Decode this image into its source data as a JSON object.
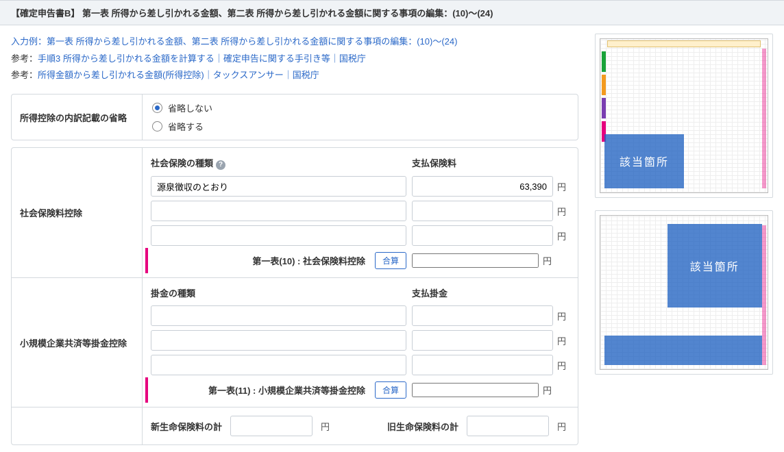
{
  "header": {
    "title": "【確定申告書B】 第一表 所得から差し引かれる金額、第二表 所得から差し引かれる金額に関する事項の編集：(10)〜(24)"
  },
  "links": {
    "example": "入力例：第一表 所得から差し引かれる金額、第二表 所得から差し引かれる金額に関する事項の編集：(10)〜(24)",
    "ref_prefix": "参考：",
    "ref1": "手順3 所得から差し引かれる金額を計算する｜確定申告に関する手引き等｜国税庁",
    "ref2": "所得金額から差し引かれる金額(所得控除)｜タックスアンサー｜国税庁"
  },
  "omit": {
    "label": "所得控除の内訳記載の省略",
    "opt_no": "省略しない",
    "opt_yes": "省略する",
    "selected": "no"
  },
  "yen": "円",
  "sum_btn": "合算",
  "social": {
    "section_label": "社会保険料控除",
    "type_head": "社会保険の種類",
    "amount_head": "支払保険料",
    "rows": [
      {
        "type": "源泉徴収のとおり",
        "amount": "63,390"
      },
      {
        "type": "",
        "amount": ""
      },
      {
        "type": "",
        "amount": ""
      }
    ],
    "total_label": "第一表(10) : 社会保険料控除",
    "total_value": ""
  },
  "sme": {
    "section_label": "小規模企業共済等掛金控除",
    "type_head": "掛金の種類",
    "amount_head": "支払掛金",
    "rows": [
      {
        "type": "",
        "amount": ""
      },
      {
        "type": "",
        "amount": ""
      },
      {
        "type": "",
        "amount": ""
      }
    ],
    "total_label": "第一表(11) : 小規模企業共済等掛金控除",
    "total_value": ""
  },
  "life": {
    "new_label": "新生命保険料の計",
    "new_value": "",
    "old_label": "旧生命保険料の計",
    "old_value": ""
  },
  "thumb_label": "該当箇所"
}
